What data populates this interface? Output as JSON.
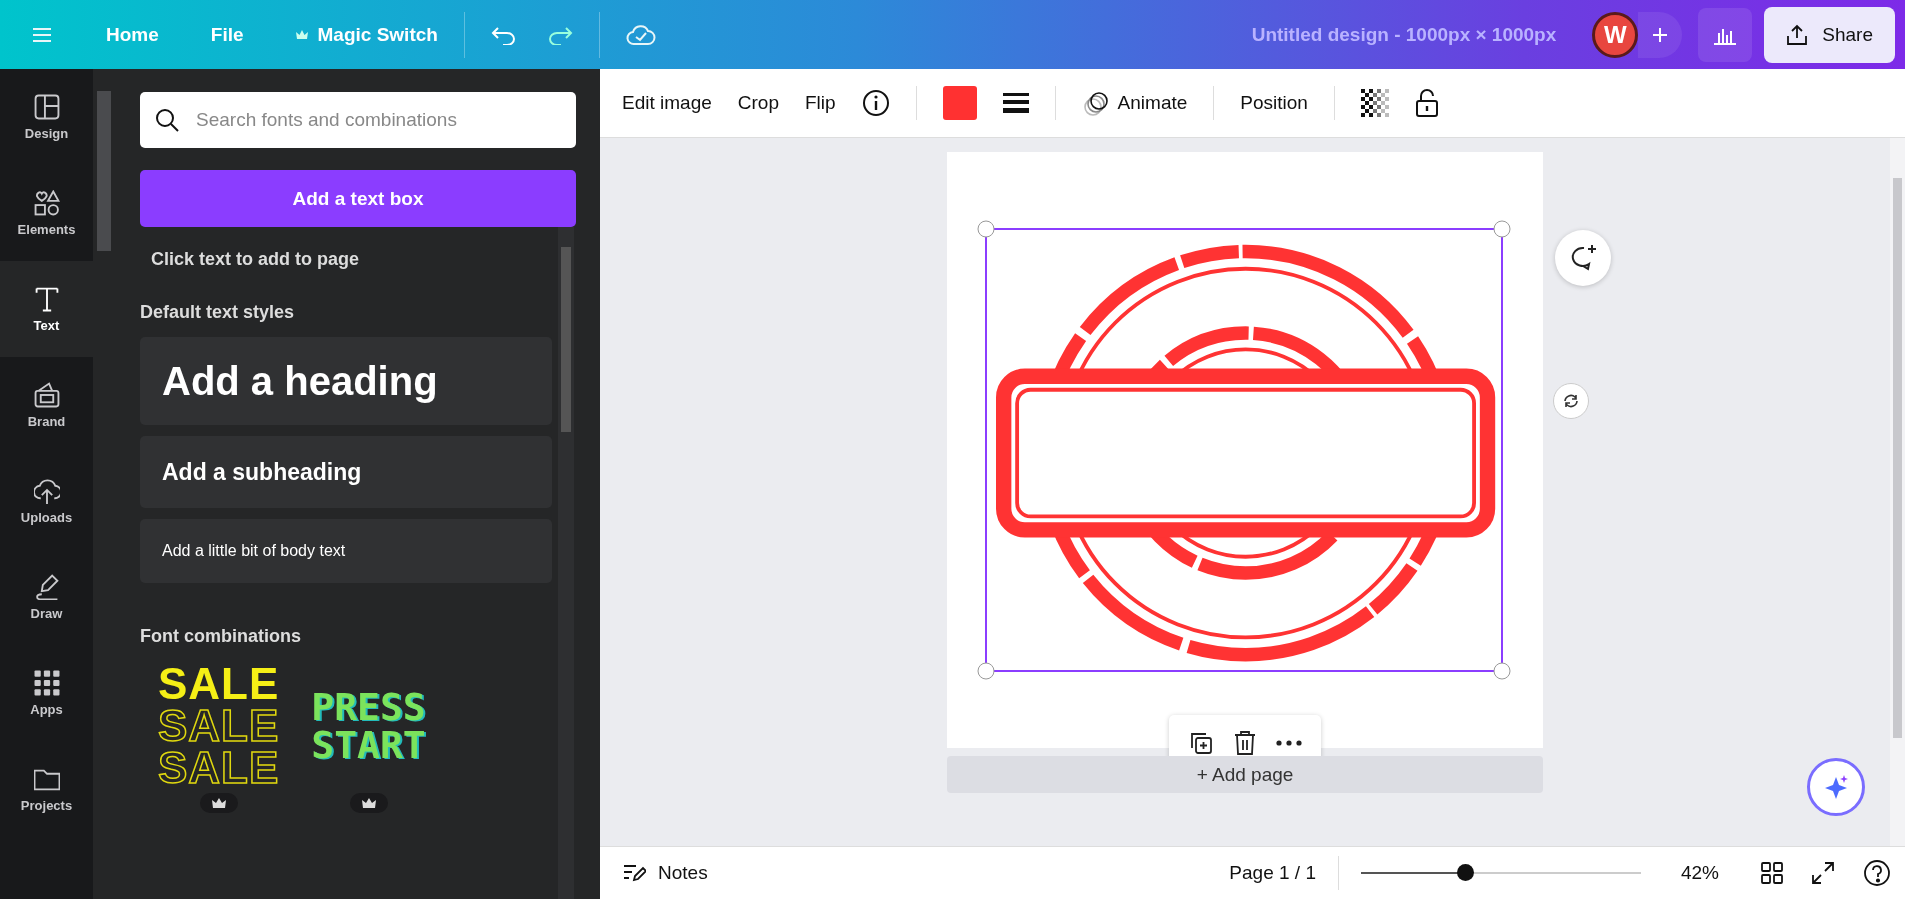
{
  "top_bar": {
    "menu": [
      {
        "label": "Home",
        "kind": "plain"
      },
      {
        "label": "File",
        "kind": "plain"
      },
      {
        "label": "Magic Switch",
        "kind": "crown"
      }
    ],
    "title": "Untitled design - 1000px × 1000px",
    "avatar": "W",
    "share": "Share"
  },
  "sidebar": {
    "items": [
      {
        "label": "Design",
        "selected": false
      },
      {
        "label": "Elements",
        "selected": false
      },
      {
        "label": "Text",
        "selected": true
      },
      {
        "label": "Brand",
        "selected": false
      },
      {
        "label": "Uploads",
        "selected": false
      },
      {
        "label": "Draw",
        "selected": false
      },
      {
        "label": "Apps",
        "selected": false
      },
      {
        "label": "Projects",
        "selected": false
      }
    ]
  },
  "panel": {
    "search": {
      "placeholder": "Search fonts and combinations"
    },
    "add_button": "Add a text box",
    "hint": "Click text to add to page",
    "default_heading": "Default text styles",
    "text_styles": [
      {
        "kind": "heading",
        "label": "Add a heading"
      },
      {
        "kind": "subheading",
        "label": "Add a subheading"
      },
      {
        "kind": "body",
        "label": "Add a little bit of body text"
      }
    ],
    "combinations_heading": "Font combinations",
    "combinations": [
      {
        "kind": "sale",
        "lines": [
          "SALE",
          "SALE",
          "SALE"
        ],
        "premium": true
      },
      {
        "kind": "press",
        "lines": [
          "PRESS",
          "START"
        ],
        "premium": true
      }
    ]
  },
  "toolbar": {
    "edit_image": "Edit image",
    "crop": "Crop",
    "flip": "Flip",
    "color": "#ff3131",
    "animate": "Animate",
    "position": "Position"
  },
  "canvas": {
    "add_page": "+ Add page"
  },
  "bottom_bar": {
    "notes": "Notes",
    "page": "Page 1 / 1",
    "zoom": {
      "level": 0.37
    },
    "zoom_label": "42%"
  }
}
